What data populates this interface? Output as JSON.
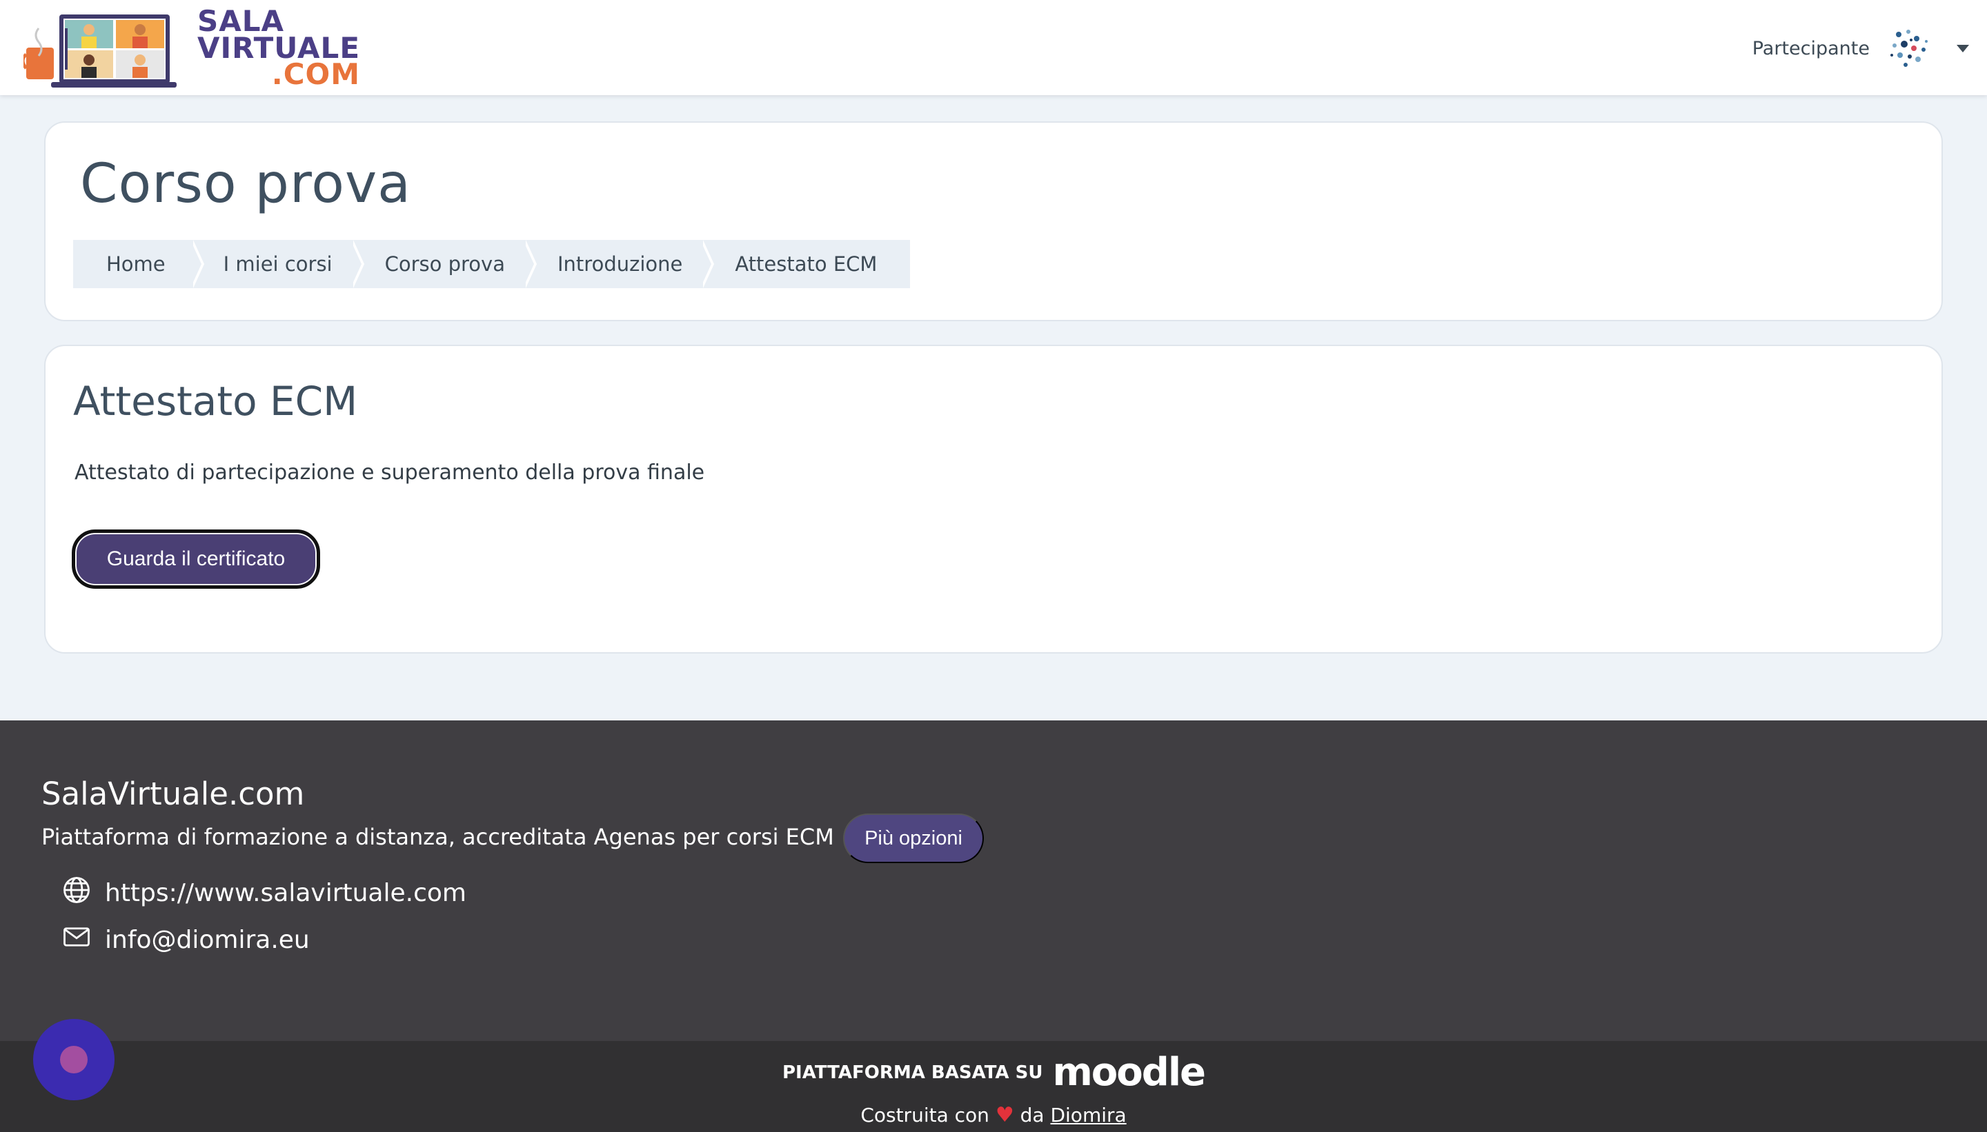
{
  "navbar": {
    "logo": {
      "line1": "SALA",
      "line2": "VIRTUALE",
      "line3": ".COM"
    },
    "user_role": "Partecipante"
  },
  "header": {
    "title": "Corso prova",
    "breadcrumb": [
      "Home",
      "I miei corsi",
      "Corso prova",
      "Introduzione",
      "Attestato ECM"
    ]
  },
  "activity": {
    "title": "Attestato ECM",
    "description": "Attestato di partecipazione e superamento della prova finale",
    "button_label": "Guarda il certificato"
  },
  "footer": {
    "site_name": "SalaVirtuale.com",
    "tagline": "Piattaforma di formazione a distanza, accreditata Agenas per corsi ECM",
    "more_options_label": "Più opzioni",
    "website": "https://www.salavirtuale.com",
    "email": "info@diomira.eu",
    "powered_prefix": "PIATTAFORMA BASATA SU",
    "powered_brand": "moodle",
    "built_prefix": "Costruita con",
    "built_middle": "da",
    "built_author": "Diomira"
  },
  "colors": {
    "brand_purple": "#4a3f74",
    "brand_orange": "#e8743b",
    "footer_bg": "#403e42",
    "page_bg": "#eef3f8"
  }
}
